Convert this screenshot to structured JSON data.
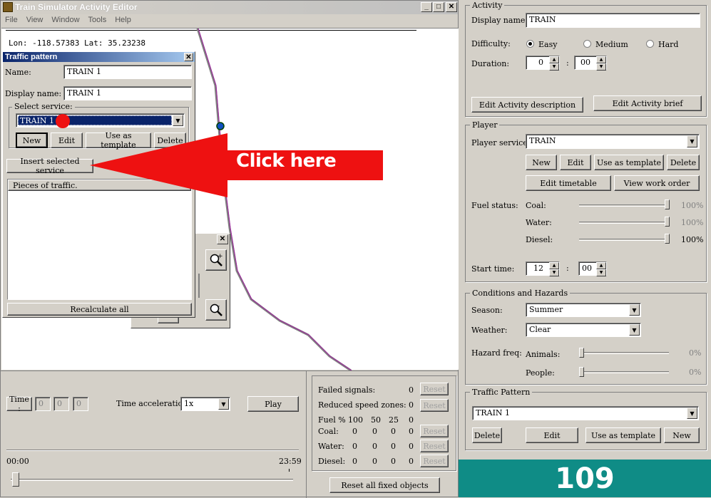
{
  "app": {
    "title": "Train Simulator Activity Editor",
    "menu": [
      "File",
      "View",
      "Window",
      "Tools",
      "Help"
    ],
    "coords": "Lon: -118.57383 Lat: 35.23238"
  },
  "traffic_pattern_window": {
    "title": "Traffic pattern",
    "name_label": "Name:",
    "name_value": "TRAIN 1",
    "display_name_label": "Display name:",
    "display_name_value": "TRAIN 1",
    "select_service_label": "Select service:",
    "selected_service": "TRAIN 1",
    "buttons": {
      "new": "New",
      "edit": "Edit",
      "use_as_template": "Use as template",
      "delete": "Delete"
    },
    "insert_selected_service": "Insert selected service",
    "pieces_header": "Pieces of traffic.",
    "recalculate_all": "Recalculate all"
  },
  "annotation": {
    "callout": "Click here"
  },
  "bottom_time": {
    "time_label": "Time :",
    "time_fields": [
      "0",
      "0",
      "0"
    ],
    "time_acceleration_label": "Time acceleration",
    "time_acceleration_value": "1x",
    "play": "Play",
    "start": "00:00",
    "end": "23:59"
  },
  "stats": {
    "failed_signals": {
      "label": "Failed signals:",
      "value": "0"
    },
    "reduced_speed_zones": {
      "label": "Reduced speed zones:",
      "value": "0"
    },
    "fuel_header": {
      "label": "Fuel %",
      "cols": [
        "100",
        "50",
        "25",
        "0"
      ]
    },
    "coal": {
      "label": "Coal:",
      "vals": [
        "0",
        "0",
        "0",
        "0"
      ]
    },
    "water": {
      "label": "Water:",
      "vals": [
        "0",
        "0",
        "0",
        "0"
      ]
    },
    "diesel": {
      "label": "Diesel:",
      "vals": [
        "0",
        "0",
        "0",
        "0"
      ]
    },
    "reset": "Reset",
    "reset_all": "Reset all fixed objects"
  },
  "activity": {
    "title": "Activity",
    "display_name_label": "Display name:",
    "display_name_value": "TRAIN",
    "difficulty_label": "Difficulty:",
    "difficulty_options": [
      "Easy",
      "Medium",
      "Hard"
    ],
    "duration_label": "Duration:",
    "duration_hours": "0",
    "duration_minutes": "00",
    "edit_description": "Edit Activity description",
    "edit_brief": "Edit Activity brief"
  },
  "player": {
    "title": "Player",
    "service_label": "Player service:",
    "service_value": "TRAIN",
    "buttons": {
      "new": "New",
      "edit": "Edit",
      "use_as_template": "Use as template",
      "delete": "Delete"
    },
    "edit_timetable": "Edit timetable",
    "view_work_order": "View work order",
    "fuel_status_label": "Fuel status:",
    "fuel": [
      {
        "label": "Coal:",
        "value": "100%",
        "level": 1.0
      },
      {
        "label": "Water:",
        "value": "100%",
        "level": 1.0
      },
      {
        "label": "Diesel:",
        "value": "100%",
        "level": 1.0
      }
    ],
    "start_time_label": "Start time:",
    "start_hours": "12",
    "start_minutes": "00"
  },
  "conditions": {
    "title": "Conditions and Hazards",
    "season_label": "Season:",
    "season_value": "Summer",
    "weather_label": "Weather:",
    "weather_value": "Clear",
    "hazard_label": "Hazard freq:",
    "animals_label": "Animals:",
    "animals_value": "0%",
    "people_label": "People:",
    "people_value": "0%"
  },
  "traffic_pattern_panel": {
    "title": "Traffic Pattern",
    "value": "TRAIN 1",
    "buttons": {
      "delete": "Delete",
      "edit": "Edit",
      "use_as_template": "Use as template",
      "new": "New"
    }
  },
  "badge": {
    "number": "109",
    "color": "#0f8c86"
  }
}
